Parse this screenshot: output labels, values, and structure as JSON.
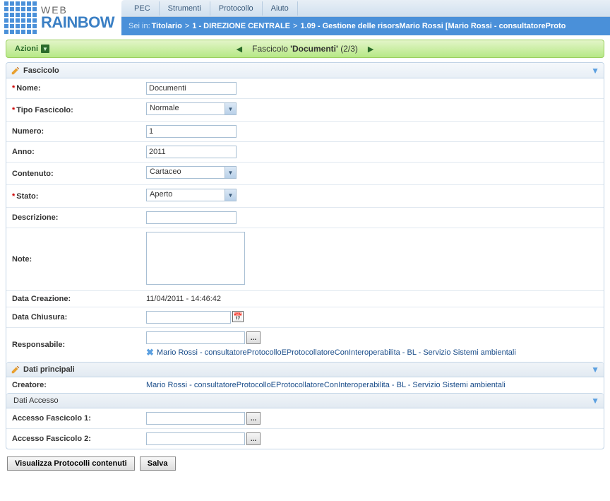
{
  "logo": {
    "web": "WEB",
    "rainbow": "RAINBOW"
  },
  "menu": {
    "pec": "PEC",
    "strumenti": "Strumenti",
    "protocollo": "Protocollo",
    "aiuto": "Aiuto"
  },
  "breadcrumb": {
    "label": "Sei in:",
    "p1": "Titolario",
    "p2": "1 - DIREZIONE CENTRALE",
    "p3": "1.09 - Gestione delle risors",
    "p4": "Mario Rossi [Mario Rossi - consultatoreProto"
  },
  "actions": {
    "label": "Azioni"
  },
  "pager": {
    "prefix": "Fascicolo ",
    "name": "'Documenti'",
    "count": " (2/3)"
  },
  "sections": {
    "fascicolo": "Fascicolo",
    "dati_principali": "Dati principali",
    "dati_accesso": "Dati Accesso"
  },
  "labels": {
    "nome": "Nome:",
    "tipo_fascicolo": "Tipo Fascicolo:",
    "numero": "Numero:",
    "anno": "Anno:",
    "contenuto": "Contenuto:",
    "stato": "Stato:",
    "descrizione": "Descrizione:",
    "note": "Note:",
    "data_creazione": "Data Creazione:",
    "data_chiusura": "Data Chiusura:",
    "responsabile": "Responsabile:",
    "creatore": "Creatore:",
    "accesso1": "Accesso Fascicolo 1:",
    "accesso2": "Accesso Fascicolo 2:"
  },
  "values": {
    "nome": "Documenti",
    "tipo_fascicolo": "Normale",
    "numero": "1",
    "anno": "2011",
    "contenuto": "Cartaceo",
    "stato": "Aperto",
    "descrizione": "",
    "note": "",
    "data_creazione": "11/04/2011 - 14:46:42",
    "data_chiusura": "",
    "responsabile_input": "",
    "responsabile_link": "Mario Rossi - consultatoreProtocolloEProtocollatoreConInteroperabilita - BL - Servizio Sistemi ambientali",
    "creatore": "Mario Rossi - consultatoreProtocolloEProtocollatoreConInteroperabilita - BL - Servizio Sistemi ambientali",
    "accesso1": "",
    "accesso2": ""
  },
  "buttons": {
    "visualizza": "Visualizza Protocolli contenuti",
    "salva": "Salva",
    "lookup": "..."
  }
}
